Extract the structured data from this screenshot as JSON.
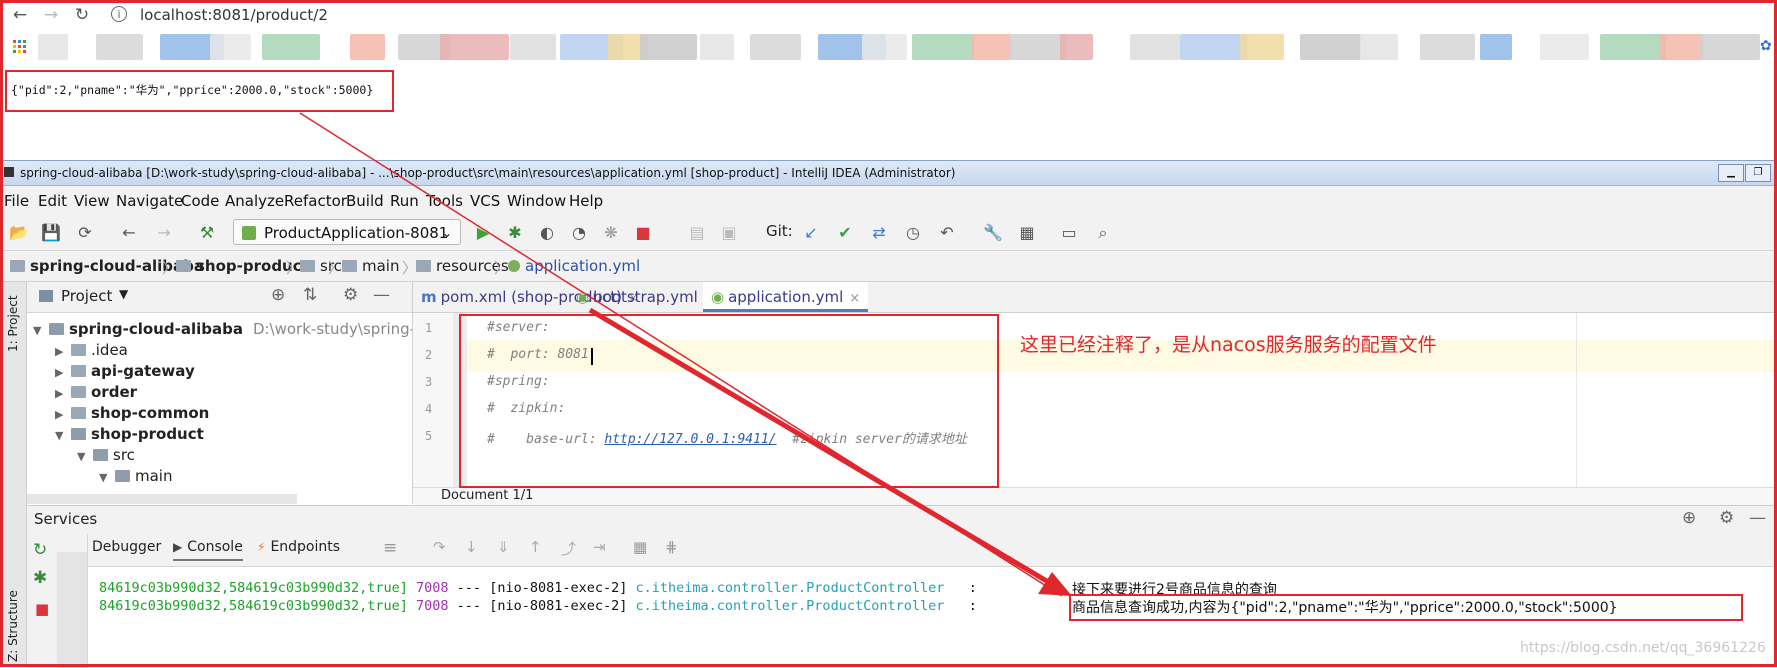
{
  "browser": {
    "url": "localhost:8081/product/2",
    "response": "{\"pid\":2,\"pname\":\"华为\",\"pprice\":2000.0,\"stock\":5000}",
    "blur_colors": [
      "#e3e3e3",
      "#d6d6d6",
      "#8fb7e8",
      "#e8e8e8",
      "#a7d3b4",
      "#f3b7a8",
      "#d0d0d0",
      "#e9b0b0",
      "#dcdcdc",
      "#b6cdf0",
      "#f0d9a0",
      "#c9c9c9"
    ]
  },
  "ide": {
    "title": "spring-cloud-alibaba [D:\\work-study\\spring-cloud-alibaba] - ...\\shop-product\\src\\main\\resources\\application.yml [shop-product] - IntelliJ IDEA (Administrator)",
    "menu": [
      "File",
      "Edit",
      "View",
      "Navigate",
      "Code",
      "Analyze",
      "Refactor",
      "Build",
      "Run",
      "Tools",
      "VCS",
      "Window",
      "Help"
    ],
    "run_config": "ProductApplication-8081",
    "git_label": "Git:",
    "breadcrumbs": [
      "spring-cloud-alibaba",
      "shop-product",
      "src",
      "main",
      "resources",
      "application.yml"
    ],
    "project_label": "Project",
    "left_strip": {
      "project": "1: Project",
      "structure": "Z: Structure"
    },
    "tree": [
      {
        "label": "spring-cloud-alibaba",
        "path": "D:\\work-study\\spring-cloud"
      },
      {
        "label": ".idea"
      },
      {
        "label": "api-gateway"
      },
      {
        "label": "order"
      },
      {
        "label": "shop-common"
      },
      {
        "label": "shop-product"
      },
      {
        "label": "src"
      },
      {
        "label": "main"
      }
    ],
    "tabs": [
      "pom.xml (shop-product)",
      "bootstrap.yml",
      "application.yml"
    ],
    "code_lines": [
      {
        "n": "1",
        "text": "#server:"
      },
      {
        "n": "2",
        "text": "#  port: 8081"
      },
      {
        "n": "3",
        "text": "#spring:"
      },
      {
        "n": "4",
        "text": "#  zipkin:"
      },
      {
        "n": "5",
        "prefix": "#    base-url: ",
        "link": "http://127.0.0.1:9411/",
        "suffix": "  #zipkin server的请求地址"
      }
    ],
    "doc_status": "Document 1/1",
    "annotation": "这里已经注释了，是从nacos服务服务的配置文件",
    "services": {
      "title": "Services",
      "tabs": [
        "Debugger",
        "Console",
        "Endpoints"
      ],
      "lines": [
        {
          "trace": "84619c03b990d32,584619c03b990d32,true]",
          "pid": "7008",
          "sep": "---",
          "thread": "[nio-8081-exec-2]",
          "logger": "c.itheima.controller.ProductController",
          "colon": ":",
          "msg": "接下来要进行2号商品信息的查询"
        },
        {
          "trace": "84619c03b990d32,584619c03b990d32,true]",
          "pid": "7008",
          "sep": "---",
          "thread": "[nio-8081-exec-2]",
          "logger": "c.itheima.controller.ProductController",
          "colon": ":",
          "msg": "商品信息查询成功,内容为{\"pid\":2,\"pname\":\"华为\",\"pprice\":2000.0,\"stock\":5000}"
        }
      ]
    }
  },
  "watermark": "https://blog.csdn.net/qq_36961226",
  "colors": {
    "accent": "#e1272e",
    "console_green": "#1aa326",
    "console_purple": "#a331b5",
    "console_cyan": "#25a0b6"
  }
}
